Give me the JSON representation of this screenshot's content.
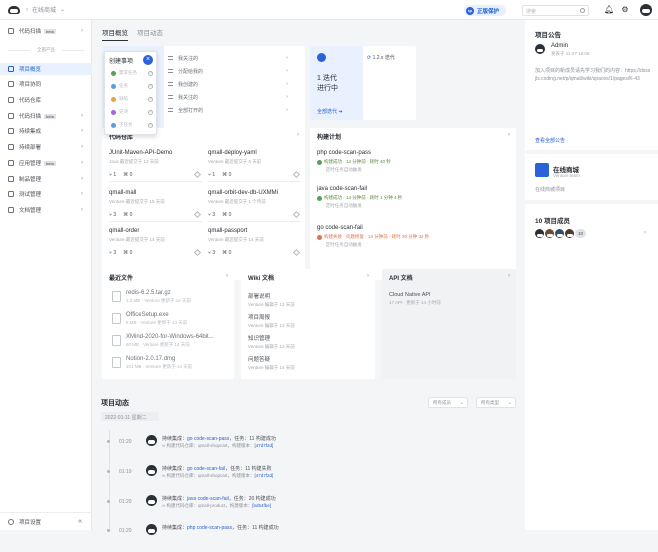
{
  "topbar": {
    "project": "在线商城",
    "brand_btn": "正版保护",
    "brand_dot": "tp",
    "search_placeholder": "搜索"
  },
  "sidebar": {
    "items_top": [
      {
        "label": "代码扫描",
        "beta": "beta"
      }
    ],
    "group": "全部产品",
    "items": [
      {
        "label": "项目概览",
        "active": true
      },
      {
        "label": "项目协同"
      },
      {
        "label": "代码仓库"
      },
      {
        "label": "代码扫描",
        "beta": "beta",
        "chev": true
      },
      {
        "label": "持续集成",
        "chev": true
      },
      {
        "label": "持续部署",
        "chev": true
      },
      {
        "label": "应用管理",
        "beta": "beta",
        "chev": true
      },
      {
        "label": "制品管理",
        "chev": true
      },
      {
        "label": "测试管理",
        "chev": true
      },
      {
        "label": "文档管理",
        "chev": true
      }
    ],
    "bottom": "项目设置",
    "collapse": "«"
  },
  "tabs": [
    "项目概览",
    "项目动态"
  ],
  "todo": {
    "title": "创建事项",
    "close": "×",
    "popup_items": [
      {
        "label": "需求任务",
        "color": "#57a05a"
      },
      {
        "label": "任务",
        "color": "#5a9be0"
      },
      {
        "label": "缺陷",
        "color": "#e8a33a"
      },
      {
        "label": "史诗",
        "color": "#a06ad8"
      },
      {
        "label": "子任务",
        "color": "#5a9be0"
      }
    ],
    "rows": [
      "我关注的",
      "分配给我的",
      "我创建的",
      "我关注的",
      "全部打开的"
    ]
  },
  "iteration": {
    "count": "1 迭代",
    "status": "进行中",
    "all": "全部迭代 ➔",
    "item": "1.2.x 迭代"
  },
  "repos": {
    "title": "代码仓库",
    "items": [
      {
        "name": "JUnit-Maven-API-Demo",
        "meta": "Java 最近提交于 13 天前",
        "branches": "1",
        "tags": "0"
      },
      {
        "name": "qmall-deploy-yaml",
        "meta": "Venture 最近提交于 6 天前",
        "branches": "1",
        "tags": "0"
      },
      {
        "name": "qmall-mall",
        "meta": "Venture 最近提交于 15 天前",
        "branches": "3",
        "tags": "0"
      },
      {
        "name": "qmall-orbit-dev-db-UXMMi",
        "meta": "Venture 最近提交于 1 个月前",
        "branches": "3",
        "tags": "0"
      },
      {
        "name": "qmall-order",
        "meta": "Venture 最近提交于 14 天前",
        "branches": "3",
        "tags": "0"
      },
      {
        "name": "qmall-passport",
        "meta": "Venture 最近提交于 14 天前",
        "branches": "3",
        "tags": "0"
      }
    ]
  },
  "builds": {
    "title": "构建计划",
    "items": [
      {
        "name": "php code-scan-pass",
        "status": "构建成功 · 14 分钟前 · 耗时 40 秒",
        "sub": "· 定时任务自动触发",
        "ok": true
      },
      {
        "name": "java code-scan-fail",
        "status": "构建成功 · 14 分钟前 · 耗时 1 分钟 4 秒",
        "sub": "· 定时任务自动触发",
        "ok": true
      },
      {
        "name": "go code-scan-fail",
        "status": "构建失败 · 问题修复 · 14 分钟前 · 耗时 20 分钟 32 秒",
        "sub": "· 定时任务自动触发",
        "ok": false
      }
    ]
  },
  "recent": {
    "title": "最近文件",
    "items": [
      {
        "name": "redis-6.2.5.tar.gz",
        "meta": "2.3 MB · Venture 更新于 14 天前"
      },
      {
        "name": "OfficeSetup.exe",
        "meta": "6 MB · Venture 更新于 14 天前"
      },
      {
        "name": "XMind-2020-for-Windows-64bit...",
        "meta": "60 MB · Venture 更新于 14 天前"
      },
      {
        "name": "Notion-2.0.17.dmg",
        "meta": "101 MB · Venture 更新于 14 天前"
      }
    ]
  },
  "wiki": {
    "title": "Wiki 文档",
    "items": [
      {
        "name": "部署说明",
        "meta": "Venture 编辑于 13 天前"
      },
      {
        "name": "项目周报",
        "meta": "Venture 编辑于 13 天前"
      },
      {
        "name": "知识管理",
        "meta": "Venture 编辑于 13 天前"
      },
      {
        "name": "问题答疑",
        "meta": "Venture 编辑于 14 天前"
      }
    ]
  },
  "api": {
    "title": "API 文档",
    "items": [
      {
        "name": "Cloud Native API",
        "meta": "17 API · 更新于 14 小时前"
      }
    ]
  },
  "feed": {
    "title": "项目动态",
    "filter1": "所有成员",
    "filter2": "所有类型",
    "date": "2022-01-11 星期二",
    "events": [
      {
        "time": "01:20",
        "pre": "持续集成：",
        "link": "go code-scan-pass",
        "post": "，任务：11 构建成功",
        "sub_pre": "∞ 构建代码仓库：qmall-shopcart，构建版本：",
        "sub_link": "[47d7f2d]"
      },
      {
        "time": "01:19",
        "pre": "持续集成：",
        "link": "go code-scan-fail",
        "post": "，任务：11 构建失败",
        "sub_pre": "∞ 构建代码仓库：qmall-shopcart，构建版本：",
        "sub_link": "[47d7f2d]"
      },
      {
        "time": "01:20",
        "pre": "持续集成：",
        "link": "java code-scan-fail",
        "post": "，任务：20 构建成功",
        "sub_pre": "∞ 构建代码仓库：qmall-product，构建版本：",
        "sub_link": "[bd54fbe]"
      },
      {
        "time": "01:20",
        "pre": "持续集成：",
        "link": "php code-scan-pass",
        "post": "，任务：11 构建成功",
        "sub_pre": "",
        "sub_link": ""
      }
    ]
  },
  "right": {
    "notice_title": "项目公告",
    "author": "Admin",
    "author_meta": "发表于 11-27 16:06",
    "notice_text_1": "加入项目的新成员请先学习我们的内容：",
    "notice_link": "https://dsssjls.coding.net/p/qmall/wiki/spaces/1/pages/K-43",
    "all_notices": "查看全部公告",
    "group_name": "在线商城",
    "group_sub": "Venture.team",
    "group_desc": "在线商城项目",
    "members_title": "10 项目成员",
    "members_count": "10"
  }
}
